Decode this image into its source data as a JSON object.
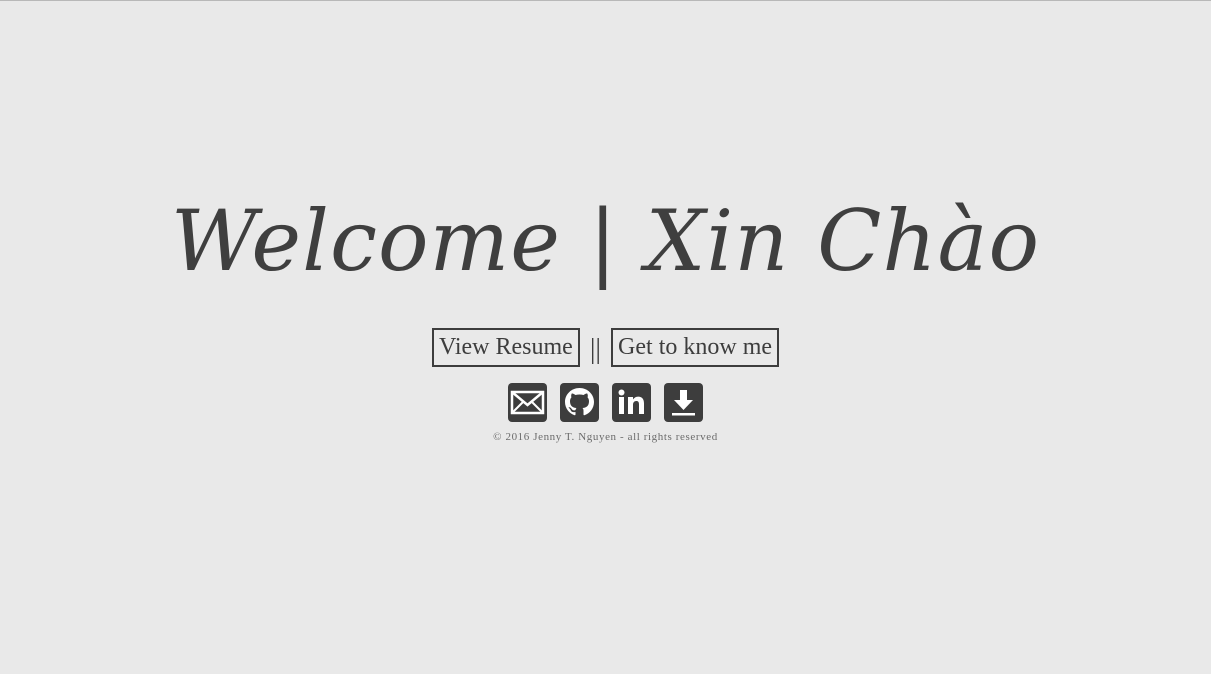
{
  "hero": {
    "title": "Welcome | Xin Chào"
  },
  "nav": {
    "resume_label": "View Resume",
    "separator": "||",
    "about_label": "Get to know me"
  },
  "social": {
    "items": [
      {
        "name": "email",
        "icon": "mail-icon"
      },
      {
        "name": "github",
        "icon": "github-icon"
      },
      {
        "name": "linkedin",
        "icon": "linkedin-icon"
      },
      {
        "name": "download",
        "icon": "download-icon"
      }
    ]
  },
  "footer": {
    "copyright": "© 2016 Jenny T. Nguyen - all rights reserved"
  },
  "colors": {
    "background": "#e9e9e9",
    "foreground": "#3d3d3d",
    "muted": "#6b6b6b"
  }
}
